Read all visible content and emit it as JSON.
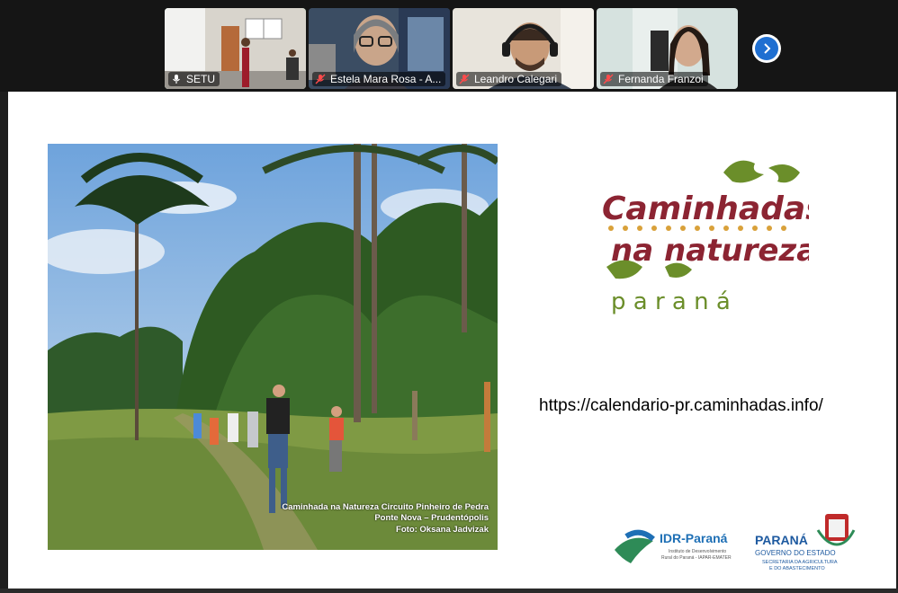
{
  "participants": [
    {
      "name": "SETU",
      "mic": "on",
      "active": true
    },
    {
      "name": "Estela Mara Rosa - A...",
      "mic": "muted",
      "active": false
    },
    {
      "name": "Leandro Calegari",
      "mic": "muted",
      "active": false
    },
    {
      "name": "Fernanda Franzoi",
      "mic": "muted",
      "active": false
    }
  ],
  "next_button_icon": "chevron-right-icon",
  "slide": {
    "photo_caption": {
      "line1": "Caminhada na Natureza Circuito Pinheiro de Pedra",
      "line2": "Ponte Nova – Prudentópolis",
      "line3": "Foto: Oksana Jadvizak"
    },
    "logo": {
      "line1": "Caminhadas",
      "line2": "na natureza",
      "line3": "p a r a n á"
    },
    "url": "https://calendario-pr.caminhadas.info/",
    "idr_logo": {
      "name": "IDR-Paraná",
      "sub1": "Instituto de Desenvolvimento",
      "sub2": "Rural do Paraná - IAPAR-EMATER"
    },
    "parana_logo": {
      "name": "PARANÁ",
      "gov": "GOVERNO DO ESTADO",
      "sec1": "SECRETARIA DA AGRICULTURA",
      "sec2": "E DO ABASTECIMENTO"
    }
  },
  "colors": {
    "active_border": "#4fd68a",
    "logo_red": "#8c2432",
    "logo_green": "#6b8e2a",
    "next_blue": "#1f6fd1"
  }
}
